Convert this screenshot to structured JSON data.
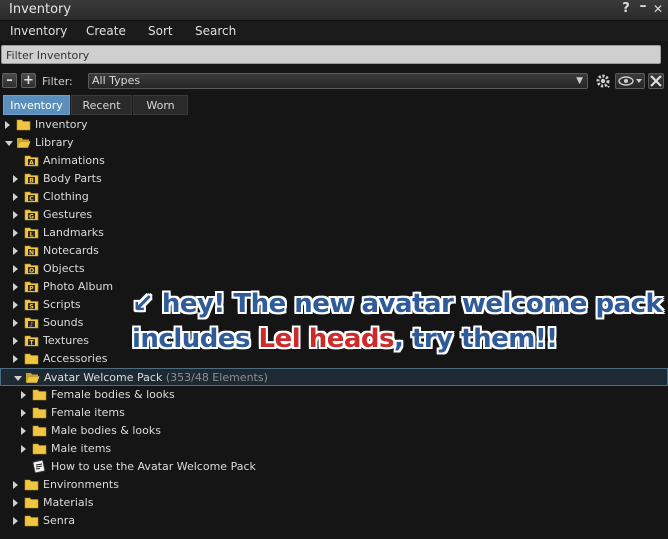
{
  "window": {
    "title": "Inventory",
    "help": "?",
    "minimize": "–",
    "close": "✕"
  },
  "menubar": [
    "Inventory",
    "Create",
    "Sort",
    "Search"
  ],
  "filter_box": {
    "text": "Filter Inventory"
  },
  "toolbar": {
    "collapse": "–",
    "expand": "+",
    "filter_label": "Filter:",
    "type_value": "All Types"
  },
  "tabs": [
    {
      "label": "Inventory",
      "active": true
    },
    {
      "label": "Recent",
      "active": false
    },
    {
      "label": "Worn",
      "active": false
    }
  ],
  "tree": [
    {
      "label": "Inventory",
      "indent": 0,
      "state": "closed",
      "icon": "folder-icon"
    },
    {
      "label": "Library",
      "indent": 0,
      "state": "open",
      "icon": "folder-open-icon"
    },
    {
      "label": "Animations",
      "indent": 1,
      "state": "none",
      "icon": "animation-folder-icon"
    },
    {
      "label": "Body Parts",
      "indent": 1,
      "state": "closed",
      "icon": "bodypart-folder-icon"
    },
    {
      "label": "Clothing",
      "indent": 1,
      "state": "closed",
      "icon": "clothing-folder-icon"
    },
    {
      "label": "Gestures",
      "indent": 1,
      "state": "closed",
      "icon": "gesture-folder-icon"
    },
    {
      "label": "Landmarks",
      "indent": 1,
      "state": "closed",
      "icon": "landmark-folder-icon"
    },
    {
      "label": "Notecards",
      "indent": 1,
      "state": "closed",
      "icon": "notecard-folder-icon"
    },
    {
      "label": "Objects",
      "indent": 1,
      "state": "closed",
      "icon": "object-folder-icon"
    },
    {
      "label": "Photo Album",
      "indent": 1,
      "state": "closed",
      "icon": "photo-folder-icon"
    },
    {
      "label": "Scripts",
      "indent": 1,
      "state": "closed",
      "icon": "script-folder-icon"
    },
    {
      "label": "Sounds",
      "indent": 1,
      "state": "closed",
      "icon": "sound-folder-icon"
    },
    {
      "label": "Textures",
      "indent": 1,
      "state": "closed",
      "icon": "texture-folder-icon"
    },
    {
      "label": "Accessories",
      "indent": 1,
      "state": "closed",
      "icon": "folder-icon"
    },
    {
      "label": "Avatar Welcome Pack",
      "suffix": " (353/48 Elements)",
      "indent": 1,
      "state": "open",
      "icon": "folder-open-icon",
      "selected": true
    },
    {
      "label": "Female bodies & looks",
      "indent": 2,
      "state": "closed",
      "icon": "folder-icon"
    },
    {
      "label": "Female items",
      "indent": 2,
      "state": "closed",
      "icon": "folder-icon"
    },
    {
      "label": "Male bodies & looks",
      "indent": 2,
      "state": "closed",
      "icon": "folder-icon"
    },
    {
      "label": "Male items",
      "indent": 2,
      "state": "closed",
      "icon": "folder-icon"
    },
    {
      "label": "How to use the Avatar Welcome Pack",
      "indent": 2,
      "state": "none",
      "icon": "notecard-item-icon"
    },
    {
      "label": "Environments",
      "indent": 1,
      "state": "closed",
      "icon": "folder-icon"
    },
    {
      "label": "Materials",
      "indent": 1,
      "state": "closed",
      "icon": "folder-icon"
    },
    {
      "label": "Senra",
      "indent": 1,
      "state": "closed",
      "icon": "folder-icon"
    }
  ],
  "overlay": {
    "line1": "↙ hey! The new avatar welcome pack",
    "line2_a": "includes ",
    "line2_b": "Lel heads",
    "line2_c": ", try them!!"
  },
  "colors": {
    "accent_tab": "#5a8fbb",
    "folder": "#f0c640",
    "overlay_blue": "#2f5c99",
    "overlay_red": "#cc2b2b"
  }
}
